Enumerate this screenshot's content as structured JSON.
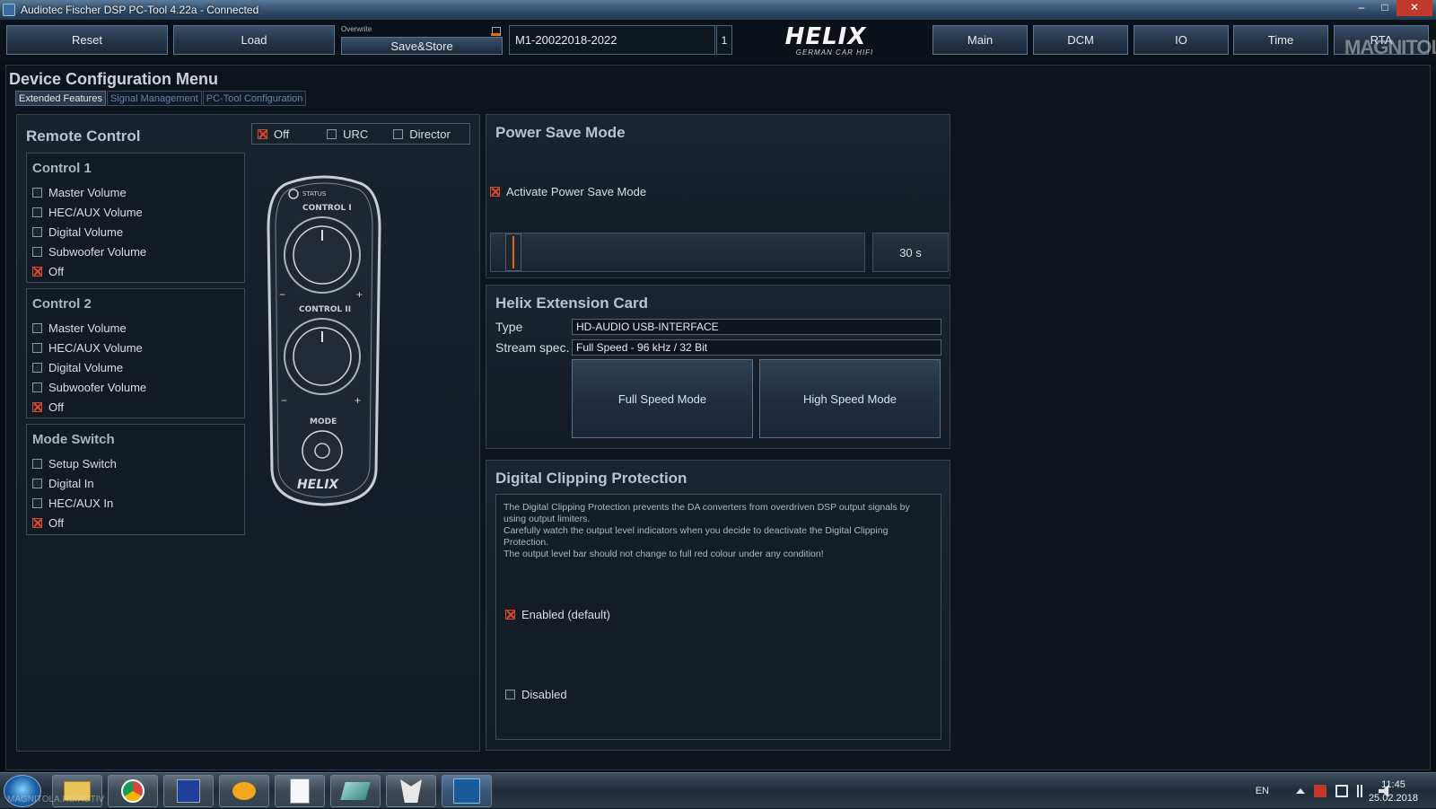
{
  "window": {
    "title": "Audiotec Fischer DSP PC-Tool 4.22a - Connected"
  },
  "toolbar": {
    "reset": "Reset",
    "load": "Load",
    "overwrite_label": "Overwrite",
    "save_store": "Save&Store",
    "preset_name": "M1-20022018-2022",
    "preset_number": "1",
    "logo_main": "HELIX",
    "logo_sub": "GERMAN CAR HIFI",
    "nav": [
      "Main",
      "DCM",
      "IO",
      "Time",
      "RTA"
    ],
    "watermark": "MAGNITOLA"
  },
  "menu": {
    "title": "Device Configuration Menu",
    "tabs": [
      "Extended Features",
      "Signal Management",
      "PC-Tool Configuration"
    ],
    "active_tab": "Extended Features"
  },
  "remote_control": {
    "title": "Remote Control",
    "options": [
      {
        "label": "Off",
        "checked": true
      },
      {
        "label": "URC",
        "checked": false
      },
      {
        "label": "Director",
        "checked": false
      }
    ],
    "groups": [
      {
        "title": "Control 1",
        "items": [
          {
            "label": "Master Volume",
            "checked": false
          },
          {
            "label": "HEC/AUX Volume",
            "checked": false
          },
          {
            "label": "Digital Volume",
            "checked": false
          },
          {
            "label": "Subwoofer Volume",
            "checked": false
          },
          {
            "label": "Off",
            "checked": true
          }
        ]
      },
      {
        "title": "Control 2",
        "items": [
          {
            "label": "Master Volume",
            "checked": false
          },
          {
            "label": "HEC/AUX Volume",
            "checked": false
          },
          {
            "label": "Digital Volume",
            "checked": false
          },
          {
            "label": "Subwoofer Volume",
            "checked": false
          },
          {
            "label": "Off",
            "checked": true
          }
        ]
      },
      {
        "title": "Mode Switch",
        "items": [
          {
            "label": "Setup Switch",
            "checked": false
          },
          {
            "label": "Digital In",
            "checked": false
          },
          {
            "label": "HEC/AUX In",
            "checked": false
          },
          {
            "label": "Off",
            "checked": true
          }
        ]
      }
    ],
    "remote_labels": {
      "control1": "CONTROL I",
      "control2": "CONTROL II",
      "mode": "MODE",
      "status": "STATUS",
      "brand": "HELIX"
    }
  },
  "power_save": {
    "title": "Power Save Mode",
    "activate_label": "Activate Power Save Mode",
    "activate_checked": true,
    "slider_fraction": 0.04,
    "value": "30 s"
  },
  "extension_card": {
    "title": "Helix Extension Card",
    "type_label": "Type",
    "type_value": "HD-AUDIO USB-INTERFACE",
    "stream_label": "Stream spec.",
    "stream_value": "Full Speed - 96 kHz / 32 Bit",
    "full_speed": "Full Speed Mode",
    "high_speed": "High Speed Mode"
  },
  "clipping": {
    "title": "Digital Clipping Protection",
    "desc1": "The Digital Clipping Protection prevents the DA converters from overdriven DSP output signals by using output limiters.",
    "desc2": "Carefully watch the output level indicators when you decide to deactivate the Digital Clipping Protection.",
    "desc3": "The output level bar should not change to full red colour under any condition!",
    "enabled_label": "Enabled (default)",
    "enabled_checked": true,
    "disabled_label": "Disabled",
    "disabled_checked": false
  },
  "taskbar": {
    "lang": "EN",
    "time": "11:45",
    "date": "25.02.2018",
    "watermark": "MAGNITOLA.RU/ACTIV"
  },
  "colors": {
    "accent": "#e0641c",
    "check": "#e8462a",
    "panel": "#1a2530"
  }
}
